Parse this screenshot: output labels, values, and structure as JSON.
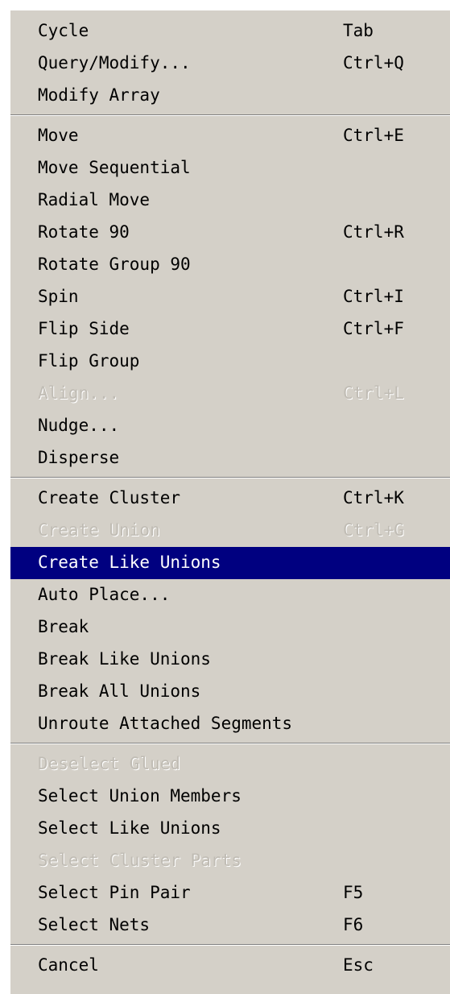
{
  "menu": {
    "groups": [
      [
        {
          "label": "Cycle",
          "shortcut": "Tab"
        },
        {
          "label": "Query/Modify...",
          "shortcut": "Ctrl+Q"
        },
        {
          "label": "Modify Array",
          "shortcut": ""
        }
      ],
      [
        {
          "label": "Move",
          "shortcut": "Ctrl+E"
        },
        {
          "label": "Move Sequential",
          "shortcut": ""
        },
        {
          "label": "Radial Move",
          "shortcut": ""
        },
        {
          "label": "Rotate 90",
          "shortcut": "Ctrl+R"
        },
        {
          "label": "Rotate Group 90",
          "shortcut": ""
        },
        {
          "label": "Spin",
          "shortcut": "Ctrl+I"
        },
        {
          "label": "Flip Side",
          "shortcut": "Ctrl+F"
        },
        {
          "label": "Flip Group",
          "shortcut": ""
        },
        {
          "label": "Align...",
          "shortcut": "Ctrl+L",
          "disabled": true
        },
        {
          "label": "Nudge...",
          "shortcut": ""
        },
        {
          "label": "Disperse",
          "shortcut": ""
        }
      ],
      [
        {
          "label": "Create Cluster",
          "shortcut": "Ctrl+K"
        },
        {
          "label": "Create Union",
          "shortcut": "Ctrl+G",
          "disabled": true
        },
        {
          "label": "Create Like Unions",
          "shortcut": "",
          "selected": true
        },
        {
          "label": "Auto Place...",
          "shortcut": ""
        },
        {
          "label": "Break",
          "shortcut": ""
        },
        {
          "label": "Break Like Unions",
          "shortcut": ""
        },
        {
          "label": "Break All Unions",
          "shortcut": ""
        },
        {
          "label": "Unroute Attached Segments",
          "shortcut": ""
        }
      ],
      [
        {
          "label": "Deselect Glued",
          "shortcut": "",
          "disabled": true
        },
        {
          "label": "Select Union Members",
          "shortcut": ""
        },
        {
          "label": "Select Like Unions",
          "shortcut": ""
        },
        {
          "label": "Select Cluster Parts",
          "shortcut": "",
          "disabled": true
        },
        {
          "label": "Select Pin Pair",
          "shortcut": "F5"
        },
        {
          "label": "Select Nets",
          "shortcut": "F6"
        }
      ],
      [
        {
          "label": "Cancel",
          "shortcut": "Esc"
        }
      ]
    ]
  }
}
